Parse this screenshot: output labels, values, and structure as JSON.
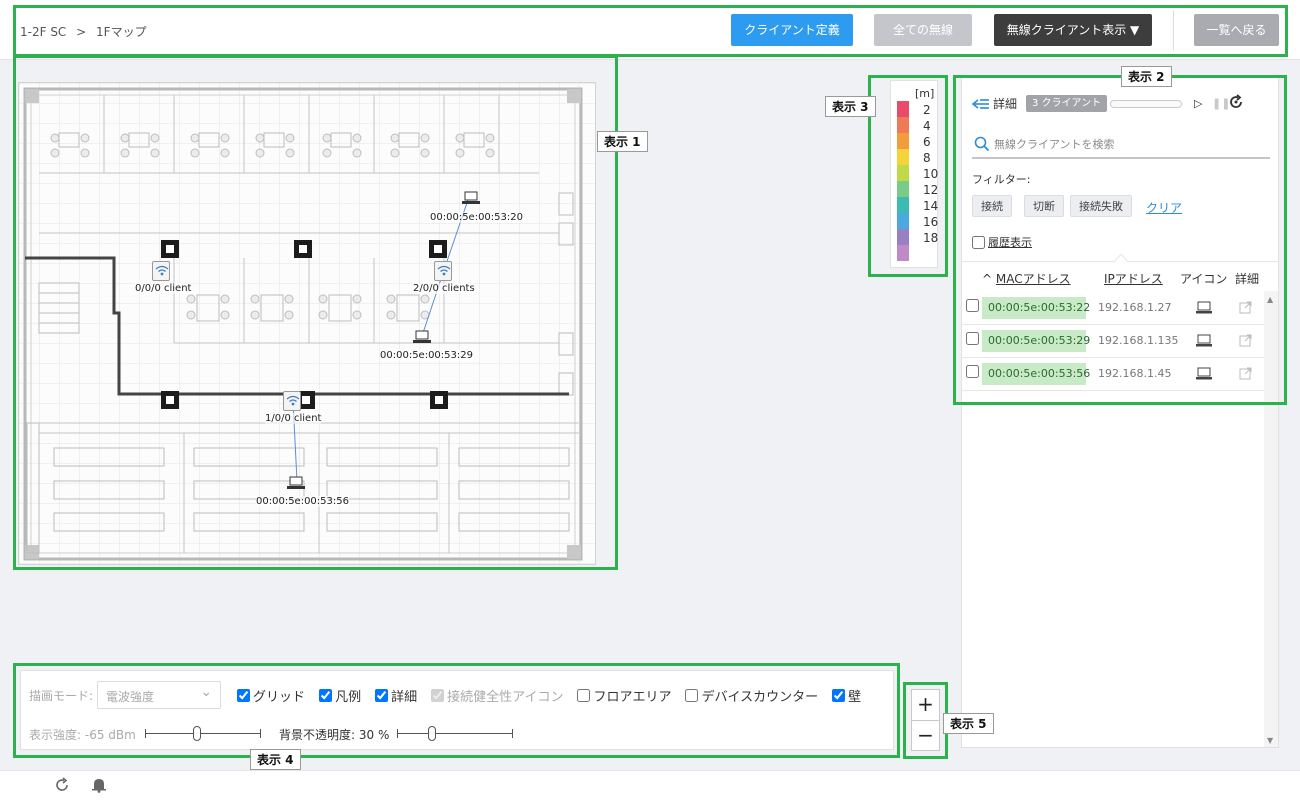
{
  "breadcrumb": {
    "site": "1-2F SC",
    "separator": ">",
    "floor": "1Fマップ"
  },
  "header": {
    "define_client": "クライアント定義",
    "all_wireless": "全ての無線",
    "show_wireless_clients": "無線クライアント表示 ▼",
    "back_to_list": "一覧へ戻る"
  },
  "annotations": {
    "a1": "表示 1",
    "a2": "表示 2",
    "a3": "表示 3",
    "a4": "表示 4",
    "a5": "表示 5"
  },
  "map": {
    "aps": [
      {
        "label": "0/0/0 client"
      },
      {
        "label": "2/0/0 clients"
      },
      {
        "label": "1/0/0 client"
      }
    ],
    "clients": [
      {
        "mac": "00:00:5e:00:53:20"
      },
      {
        "mac": "00:00:5e:00:53:29"
      },
      {
        "mac": "00:00:5e:00:53:56"
      }
    ]
  },
  "legend": {
    "unit": "[m]",
    "items": [
      {
        "value": "2",
        "color": "#e84c6a"
      },
      {
        "value": "4",
        "color": "#ef7a57"
      },
      {
        "value": "6",
        "color": "#f29c3c"
      },
      {
        "value": "8",
        "color": "#f5d43a"
      },
      {
        "value": "10",
        "color": "#bfd949"
      },
      {
        "value": "12",
        "color": "#7acb8a"
      },
      {
        "value": "14",
        "color": "#3cbcb0"
      },
      {
        "value": "16",
        "color": "#4ca9df"
      },
      {
        "value": "18",
        "color": "#9a7fc2"
      },
      {
        "value": "",
        "color": "#c08ac6"
      }
    ]
  },
  "panel": {
    "detail_label": "詳細",
    "client_count_badge": "3 クライアント",
    "search_placeholder": "無線クライアントを検索",
    "filter_label": "フィルター:",
    "filters": [
      "接続",
      "切断",
      "接続失敗"
    ],
    "clear": "クリア",
    "history": "履歴表示",
    "columns": {
      "mac": "MACアドレス",
      "ip": "IPアドレス",
      "icon": "アイコン",
      "detail": "詳細"
    },
    "sort_indicator": "^",
    "rows": [
      {
        "mac": "00:00:5e:00:53:22",
        "ip": "192.168.1.27"
      },
      {
        "mac": "00:00:5e:00:53:29",
        "ip": "192.168.1.135"
      },
      {
        "mac": "00:00:5e:00:53:56",
        "ip": "192.168.1.45"
      }
    ]
  },
  "controls": {
    "draw_mode_label": "描画モード:",
    "draw_mode_value": "電波強度",
    "checks": [
      {
        "label": "グリッド",
        "checked": true,
        "disabled": false
      },
      {
        "label": "凡例",
        "checked": true,
        "disabled": false
      },
      {
        "label": "詳細",
        "checked": true,
        "disabled": false
      },
      {
        "label": "接続健全性アイコン",
        "checked": true,
        "disabled": true
      },
      {
        "label": "フロアエリア",
        "checked": false,
        "disabled": false
      },
      {
        "label": "デバイスカウンター",
        "checked": false,
        "disabled": false
      },
      {
        "label": "壁",
        "checked": true,
        "disabled": false
      }
    ],
    "strength_label": "表示強度: -65 dBm",
    "opacity_label": "背景不透明度: 30 %",
    "strength_level": 0.45,
    "opacity_level": 0.3
  },
  "zoom": {
    "in": "+",
    "out": "−"
  }
}
